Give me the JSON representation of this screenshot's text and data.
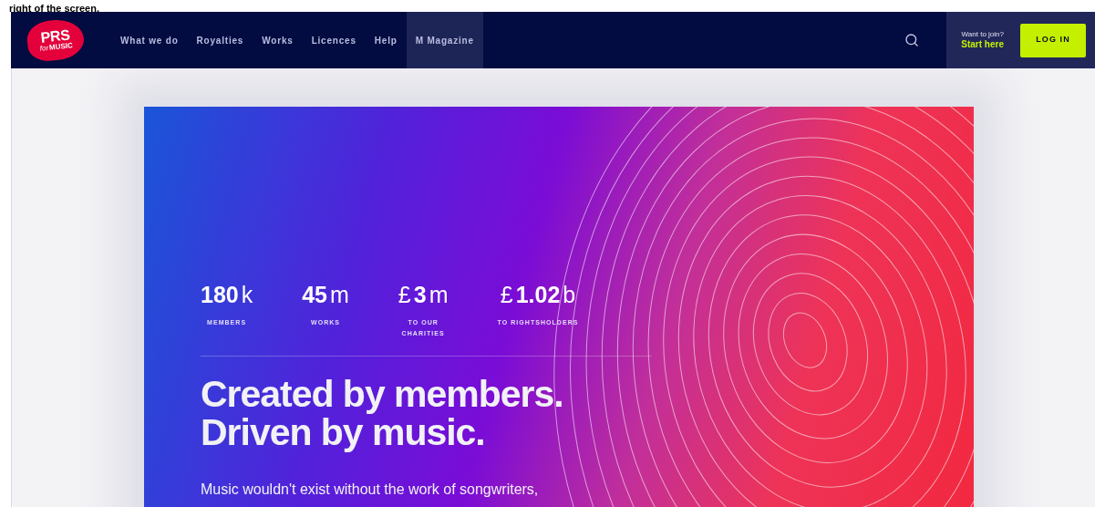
{
  "caption": "right of the screen.",
  "nav": {
    "logo": {
      "main": "PRS",
      "sub_italic": "for",
      "sub": "MUSIC"
    },
    "items": [
      {
        "label": "What we do",
        "selected": false
      },
      {
        "label": "Royalties",
        "selected": false
      },
      {
        "label": "Works",
        "selected": false
      },
      {
        "label": "Licences",
        "selected": false
      },
      {
        "label": "Help",
        "selected": false
      },
      {
        "label": "M Magazine",
        "selected": true
      }
    ],
    "join": {
      "question": "Want to join?",
      "link": "Start here"
    },
    "login": "LOG IN"
  },
  "hero": {
    "stats": [
      {
        "value": "180",
        "suffix": "k",
        "label_lines": [
          "MEMBERS"
        ]
      },
      {
        "value": "45",
        "suffix": "m",
        "label_lines": [
          "WORKS"
        ]
      },
      {
        "prefix": "£",
        "value": "3",
        "suffix": "m",
        "label_lines": [
          "TO OUR",
          "CHARITIES"
        ]
      },
      {
        "prefix": "£",
        "value": "1.02",
        "suffix": "b",
        "label_lines": [
          "TO RIGHTSHOLDERS"
        ]
      }
    ],
    "headline": [
      "Created by members.",
      "Driven by music."
    ],
    "text": "Music wouldn't exist without the work of songwriters,"
  }
}
